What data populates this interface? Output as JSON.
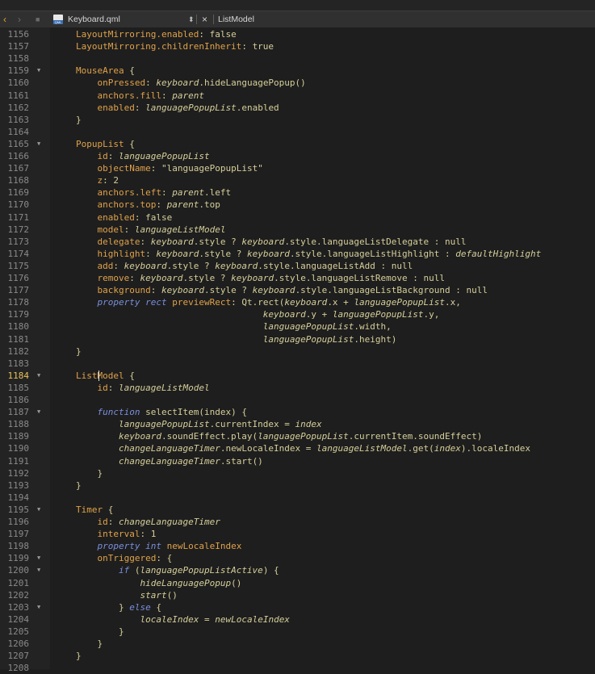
{
  "toolbar": {
    "back_icon": "‹",
    "forward_icon": "›",
    "file_icon_text": "QML",
    "file_name": "Keyboard.qml",
    "updown_icon": "⬍",
    "close_icon": "×",
    "symbol": "ListModel"
  },
  "editor": {
    "current_line": "1184",
    "lines": [
      {
        "n": "1156",
        "fold": false,
        "code": [
          [
            "p",
            "LayoutMirroring.enabled"
          ],
          [
            "o",
            ": "
          ],
          [
            "n",
            "false"
          ]
        ]
      },
      {
        "n": "1157",
        "fold": false,
        "code": [
          [
            "p",
            "LayoutMirroring.childrenInherit"
          ],
          [
            "o",
            ": "
          ],
          [
            "n",
            "true"
          ]
        ]
      },
      {
        "n": "1158",
        "fold": false,
        "code": []
      },
      {
        "n": "1159",
        "fold": true,
        "code": [
          [
            "t",
            "MouseArea"
          ],
          [
            "o",
            " {"
          ]
        ]
      },
      {
        "n": "1160",
        "fold": false,
        "code": [
          [
            "o",
            "    "
          ],
          [
            "p",
            "onPressed"
          ],
          [
            "o",
            ": "
          ],
          [
            "i",
            "keyboard"
          ],
          [
            "o",
            ".hideLanguagePopup()"
          ]
        ]
      },
      {
        "n": "1161",
        "fold": false,
        "code": [
          [
            "o",
            "    "
          ],
          [
            "p",
            "anchors.fill"
          ],
          [
            "o",
            ": "
          ],
          [
            "i",
            "parent"
          ]
        ]
      },
      {
        "n": "1162",
        "fold": false,
        "code": [
          [
            "o",
            "    "
          ],
          [
            "p",
            "enabled"
          ],
          [
            "o",
            ": "
          ],
          [
            "i",
            "languagePopupList"
          ],
          [
            "o",
            ".enabled"
          ]
        ]
      },
      {
        "n": "1163",
        "fold": false,
        "code": [
          [
            "o",
            "}"
          ]
        ]
      },
      {
        "n": "1164",
        "fold": false,
        "code": []
      },
      {
        "n": "1165",
        "fold": true,
        "code": [
          [
            "t",
            "PopupList"
          ],
          [
            "o",
            " {"
          ]
        ]
      },
      {
        "n": "1166",
        "fold": false,
        "code": [
          [
            "o",
            "    "
          ],
          [
            "p",
            "id"
          ],
          [
            "o",
            ": "
          ],
          [
            "i",
            "languagePopupList"
          ]
        ]
      },
      {
        "n": "1167",
        "fold": false,
        "code": [
          [
            "o",
            "    "
          ],
          [
            "p",
            "objectName"
          ],
          [
            "o",
            ": "
          ],
          [
            "s",
            "\"languagePopupList\""
          ]
        ]
      },
      {
        "n": "1168",
        "fold": false,
        "code": [
          [
            "o",
            "    "
          ],
          [
            "p",
            "z"
          ],
          [
            "o",
            ": "
          ],
          [
            "n",
            "2"
          ]
        ]
      },
      {
        "n": "1169",
        "fold": false,
        "code": [
          [
            "o",
            "    "
          ],
          [
            "p",
            "anchors.left"
          ],
          [
            "o",
            ": "
          ],
          [
            "i",
            "parent"
          ],
          [
            "o",
            ".left"
          ]
        ]
      },
      {
        "n": "1170",
        "fold": false,
        "code": [
          [
            "o",
            "    "
          ],
          [
            "p",
            "anchors.top"
          ],
          [
            "o",
            ": "
          ],
          [
            "i",
            "parent"
          ],
          [
            "o",
            ".top"
          ]
        ]
      },
      {
        "n": "1171",
        "fold": false,
        "code": [
          [
            "o",
            "    "
          ],
          [
            "p",
            "enabled"
          ],
          [
            "o",
            ": "
          ],
          [
            "n",
            "false"
          ]
        ]
      },
      {
        "n": "1172",
        "fold": false,
        "code": [
          [
            "o",
            "    "
          ],
          [
            "p",
            "model"
          ],
          [
            "o",
            ": "
          ],
          [
            "i",
            "languageListModel"
          ]
        ]
      },
      {
        "n": "1173",
        "fold": false,
        "code": [
          [
            "o",
            "    "
          ],
          [
            "p",
            "delegate"
          ],
          [
            "o",
            ": "
          ],
          [
            "i",
            "keyboard"
          ],
          [
            "o",
            ".style ? "
          ],
          [
            "i",
            "keyboard"
          ],
          [
            "o",
            ".style.languageListDelegate : null"
          ]
        ]
      },
      {
        "n": "1174",
        "fold": false,
        "code": [
          [
            "o",
            "    "
          ],
          [
            "p",
            "highlight"
          ],
          [
            "o",
            ": "
          ],
          [
            "i",
            "keyboard"
          ],
          [
            "o",
            ".style ? "
          ],
          [
            "i",
            "keyboard"
          ],
          [
            "o",
            ".style.languageListHighlight : "
          ],
          [
            "i",
            "defaultHighlight"
          ]
        ]
      },
      {
        "n": "1175",
        "fold": false,
        "code": [
          [
            "o",
            "    "
          ],
          [
            "p",
            "add"
          ],
          [
            "o",
            ": "
          ],
          [
            "i",
            "keyboard"
          ],
          [
            "o",
            ".style ? "
          ],
          [
            "i",
            "keyboard"
          ],
          [
            "o",
            ".style.languageListAdd : null"
          ]
        ]
      },
      {
        "n": "1176",
        "fold": false,
        "code": [
          [
            "o",
            "    "
          ],
          [
            "p",
            "remove"
          ],
          [
            "o",
            ": "
          ],
          [
            "i",
            "keyboard"
          ],
          [
            "o",
            ".style ? "
          ],
          [
            "i",
            "keyboard"
          ],
          [
            "o",
            ".style.languageListRemove : null"
          ]
        ]
      },
      {
        "n": "1177",
        "fold": false,
        "code": [
          [
            "o",
            "    "
          ],
          [
            "p",
            "background"
          ],
          [
            "o",
            ": "
          ],
          [
            "i",
            "keyboard"
          ],
          [
            "o",
            ".style ? "
          ],
          [
            "i",
            "keyboard"
          ],
          [
            "o",
            ".style.languageListBackground : null"
          ]
        ]
      },
      {
        "n": "1178",
        "fold": false,
        "code": [
          [
            "o",
            "    "
          ],
          [
            "k",
            "property"
          ],
          [
            "o",
            " "
          ],
          [
            "k",
            "rect"
          ],
          [
            "o",
            " "
          ],
          [
            "p",
            "previewRect"
          ],
          [
            "o",
            ": Qt.rect("
          ],
          [
            "i",
            "keyboard"
          ],
          [
            "o",
            ".x + "
          ],
          [
            "i",
            "languagePopupList"
          ],
          [
            "o",
            ".x,"
          ]
        ]
      },
      {
        "n": "1179",
        "fold": false,
        "code": [
          [
            "o",
            "                                   "
          ],
          [
            "i",
            "keyboard"
          ],
          [
            "o",
            ".y + "
          ],
          [
            "i",
            "languagePopupList"
          ],
          [
            "o",
            ".y,"
          ]
        ]
      },
      {
        "n": "1180",
        "fold": false,
        "code": [
          [
            "o",
            "                                   "
          ],
          [
            "i",
            "languagePopupList"
          ],
          [
            "o",
            ".width,"
          ]
        ]
      },
      {
        "n": "1181",
        "fold": false,
        "code": [
          [
            "o",
            "                                   "
          ],
          [
            "i",
            "languagePopupList"
          ],
          [
            "o",
            ".height)"
          ]
        ]
      },
      {
        "n": "1182",
        "fold": false,
        "code": [
          [
            "o",
            "}"
          ]
        ]
      },
      {
        "n": "1183",
        "fold": false,
        "code": []
      },
      {
        "n": "1184",
        "fold": true,
        "code": [
          [
            "t",
            "ListModel"
          ],
          [
            "o",
            " {"
          ]
        ]
      },
      {
        "n": "1185",
        "fold": false,
        "code": [
          [
            "o",
            "    "
          ],
          [
            "p",
            "id"
          ],
          [
            "o",
            ": "
          ],
          [
            "i",
            "languageListModel"
          ]
        ]
      },
      {
        "n": "1186",
        "fold": false,
        "code": []
      },
      {
        "n": "1187",
        "fold": true,
        "code": [
          [
            "o",
            "    "
          ],
          [
            "k",
            "function"
          ],
          [
            "o",
            " selectItem(index) {"
          ]
        ]
      },
      {
        "n": "1188",
        "fold": false,
        "code": [
          [
            "o",
            "        "
          ],
          [
            "i",
            "languagePopupList"
          ],
          [
            "o",
            ".currentIndex = "
          ],
          [
            "i",
            "index"
          ]
        ]
      },
      {
        "n": "1189",
        "fold": false,
        "code": [
          [
            "o",
            "        "
          ],
          [
            "i",
            "keyboard"
          ],
          [
            "o",
            ".soundEffect.play("
          ],
          [
            "i",
            "languagePopupList"
          ],
          [
            "o",
            ".currentItem.soundEffect)"
          ]
        ]
      },
      {
        "n": "1190",
        "fold": false,
        "code": [
          [
            "o",
            "        "
          ],
          [
            "i",
            "changeLanguageTimer"
          ],
          [
            "o",
            ".newLocaleIndex = "
          ],
          [
            "i",
            "languageListModel"
          ],
          [
            "o",
            ".get("
          ],
          [
            "i",
            "index"
          ],
          [
            "o",
            ").localeIndex"
          ]
        ]
      },
      {
        "n": "1191",
        "fold": false,
        "code": [
          [
            "o",
            "        "
          ],
          [
            "i",
            "changeLanguageTimer"
          ],
          [
            "o",
            ".start()"
          ]
        ]
      },
      {
        "n": "1192",
        "fold": false,
        "code": [
          [
            "o",
            "    }"
          ]
        ]
      },
      {
        "n": "1193",
        "fold": false,
        "code": [
          [
            "o",
            "}"
          ]
        ]
      },
      {
        "n": "1194",
        "fold": false,
        "code": []
      },
      {
        "n": "1195",
        "fold": true,
        "code": [
          [
            "t",
            "Timer"
          ],
          [
            "o",
            " {"
          ]
        ]
      },
      {
        "n": "1196",
        "fold": false,
        "code": [
          [
            "o",
            "    "
          ],
          [
            "p",
            "id"
          ],
          [
            "o",
            ": "
          ],
          [
            "i",
            "changeLanguageTimer"
          ]
        ]
      },
      {
        "n": "1197",
        "fold": false,
        "code": [
          [
            "o",
            "    "
          ],
          [
            "p",
            "interval"
          ],
          [
            "o",
            ": "
          ],
          [
            "n",
            "1"
          ]
        ]
      },
      {
        "n": "1198",
        "fold": false,
        "code": [
          [
            "o",
            "    "
          ],
          [
            "k",
            "property"
          ],
          [
            "o",
            " "
          ],
          [
            "k",
            "int"
          ],
          [
            "o",
            " "
          ],
          [
            "p",
            "newLocaleIndex"
          ]
        ]
      },
      {
        "n": "1199",
        "fold": true,
        "code": [
          [
            "o",
            "    "
          ],
          [
            "p",
            "onTriggered"
          ],
          [
            "o",
            ": {"
          ]
        ]
      },
      {
        "n": "1200",
        "fold": true,
        "code": [
          [
            "o",
            "        "
          ],
          [
            "k",
            "if"
          ],
          [
            "o",
            " ("
          ],
          [
            "i",
            "languagePopupListActive"
          ],
          [
            "o",
            ") {"
          ]
        ]
      },
      {
        "n": "1201",
        "fold": false,
        "code": [
          [
            "o",
            "            "
          ],
          [
            "i",
            "hideLanguagePopup"
          ],
          [
            "o",
            "()"
          ]
        ]
      },
      {
        "n": "1202",
        "fold": false,
        "code": [
          [
            "o",
            "            "
          ],
          [
            "i",
            "start"
          ],
          [
            "o",
            "()"
          ]
        ]
      },
      {
        "n": "1203",
        "fold": true,
        "code": [
          [
            "o",
            "        } "
          ],
          [
            "k",
            "else"
          ],
          [
            "o",
            " {"
          ]
        ]
      },
      {
        "n": "1204",
        "fold": false,
        "code": [
          [
            "o",
            "            "
          ],
          [
            "i",
            "localeIndex"
          ],
          [
            "o",
            " = "
          ],
          [
            "i",
            "newLocaleIndex"
          ]
        ]
      },
      {
        "n": "1205",
        "fold": false,
        "code": [
          [
            "o",
            "        }"
          ]
        ]
      },
      {
        "n": "1206",
        "fold": false,
        "code": [
          [
            "o",
            "    }"
          ]
        ]
      },
      {
        "n": "1207",
        "fold": false,
        "code": [
          [
            "o",
            "}"
          ]
        ]
      },
      {
        "n": "1208",
        "fold": false,
        "code": []
      }
    ]
  }
}
